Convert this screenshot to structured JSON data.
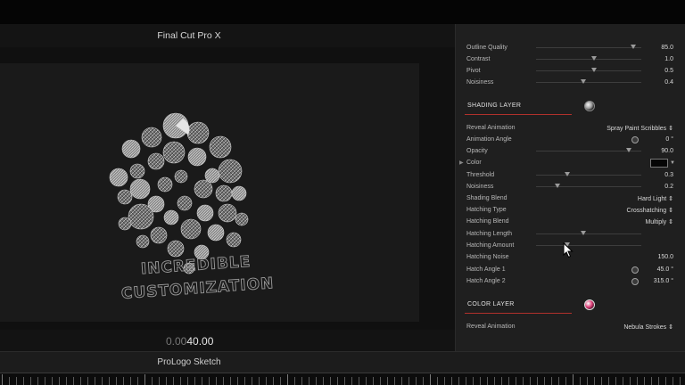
{
  "app": {
    "title": "Final Cut Pro X"
  },
  "viewer": {
    "logo_text": [
      "INCREDIBLE",
      "CUSTOMIZATION"
    ],
    "timecode_dim": "0.00",
    "timecode_bright": "40.00"
  },
  "clip": {
    "name": "ProLogo Sketch"
  },
  "inspector": {
    "top_rows": [
      {
        "label": "Outline Quality",
        "value": "85.0",
        "level": 0.92
      },
      {
        "label": "Contrast",
        "value": "1.0",
        "level": 0.55
      },
      {
        "label": "Pivot",
        "value": "0.5",
        "level": 0.55
      },
      {
        "label": "Noisiness",
        "value": "0.4",
        "level": 0.45
      }
    ],
    "shading_section": {
      "title": "SHADING LAYER",
      "icon": "shading-ball-icon"
    },
    "shading_rows": {
      "reveal_animation": {
        "label": "Reveal Animation",
        "value": "Spray Paint Scribbles ⇕"
      },
      "animation_angle": {
        "label": "Animation Angle",
        "value": "0 °"
      },
      "opacity": {
        "label": "Opacity",
        "value": "90.0",
        "level": 0.88
      },
      "color": {
        "label": "Color",
        "swatch": "#050505"
      },
      "threshold": {
        "label": "Threshold",
        "value": "0.3",
        "level": 0.3
      },
      "noisiness": {
        "label": "Noisiness",
        "value": "0.2",
        "level": 0.2
      },
      "shading_blend": {
        "label": "Shading Blend",
        "value": "Hard Light ⇕"
      },
      "hatching_type": {
        "label": "Hatching Type",
        "value": "Crosshatching ⇕"
      },
      "hatching_blend": {
        "label": "Hatching Blend",
        "value": "Multiply ⇕"
      },
      "hatching_length": {
        "label": "Hatching Length",
        "level": 0.45
      },
      "hatching_amount": {
        "label": "Hatching Amount",
        "level": 0.3
      },
      "hatching_noise": {
        "label": "Hatching Noise",
        "value": "150.0"
      },
      "hatch_angle_1": {
        "label": "Hatch Angle 1",
        "value": "45.0 °"
      },
      "hatch_angle_2": {
        "label": "Hatch Angle 2",
        "value": "315.0 °"
      }
    },
    "color_section": {
      "title": "COLOR LAYER",
      "icon": "color-ball-icon"
    },
    "color_rows": {
      "reveal_animation": {
        "label": "Reveal Animation",
        "value": "Nebula Strokes ⇕"
      }
    }
  },
  "colors": {
    "accent_underline": "#b0312c",
    "color_ball": "#e0407a",
    "background": "#000000",
    "inspector_bg": "#1f1f1f"
  }
}
